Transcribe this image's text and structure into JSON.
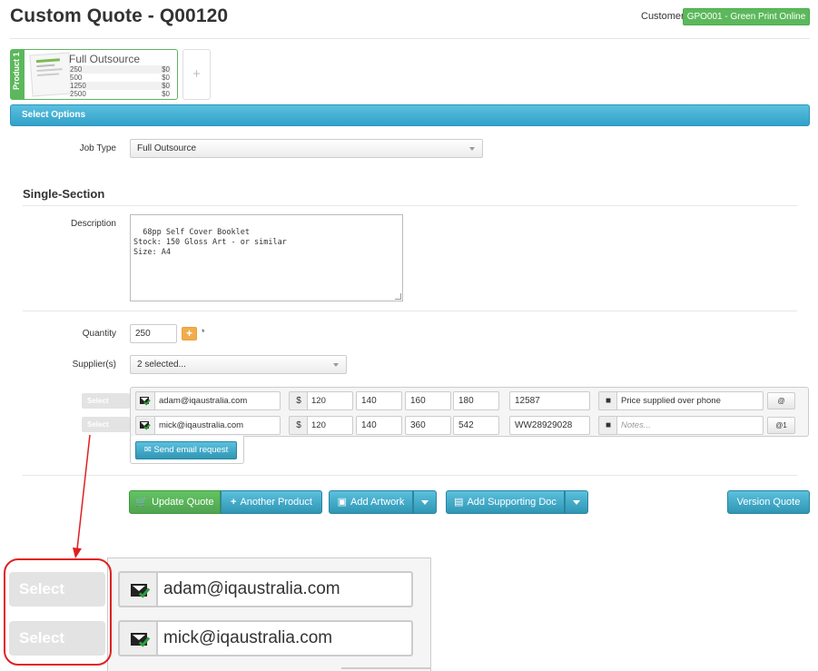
{
  "header": {
    "title": "Custom Quote - Q00120",
    "customer_label": "Customer",
    "customer_value": "GPO001 - Green Print Online"
  },
  "product": {
    "tab_label": "Product 1",
    "name": "Full Outsource",
    "prices": [
      {
        "qty": "250",
        "price": "$0"
      },
      {
        "qty": "500",
        "price": "$0"
      },
      {
        "qty": "1250",
        "price": "$0"
      },
      {
        "qty": "2500",
        "price": "$0"
      }
    ],
    "add_label": "+"
  },
  "options": {
    "bar_title": "Select Options",
    "job_type_label": "Job Type",
    "job_type_value": "Full Outsource"
  },
  "section": {
    "title": "Single-Section",
    "description_label": "Description",
    "description_value": "68pp Self Cover Booklet\nStock: 150 Gloss Art - or similar\nSize: A4",
    "quantity_label": "Quantity",
    "quantity_value": "250",
    "quantity_plus": "+",
    "required_mark": "*",
    "suppliers_label": "Supplier(s)",
    "suppliers_value": "2 selected..."
  },
  "suppliers": {
    "select_label": "Select",
    "currency": "$",
    "rows": [
      {
        "email": "adam@iqaustralia.com",
        "p1": "120",
        "p2": "140",
        "p3": "160",
        "p4": "180",
        "ref": "12587",
        "note": "Price supplied over phone",
        "note_placeholder": "",
        "at_label": "@"
      },
      {
        "email": "mick@iqaustralia.com",
        "p1": "120",
        "p2": "140",
        "p3": "360",
        "p4": "542",
        "ref": "WW28929028",
        "note": "",
        "note_placeholder": "Notes...",
        "at_label": "@1"
      }
    ],
    "send_label": "Send email request"
  },
  "actions": {
    "update_quote": "Update Quote",
    "another_product": "Another Product",
    "add_artwork": "Add Artwork",
    "add_supporting_doc": "Add Supporting Doc",
    "version_quote": "Version Quote"
  },
  "zoom": {
    "select_label": "Select",
    "emails": [
      "adam@iqaustralia.com",
      "mick@iqaustralia.com"
    ]
  },
  "colors": {
    "green": "#5cb85c",
    "blue": "#31a1c9",
    "orange": "#f0ad4e",
    "red_annotation": "#e02020"
  },
  "icons": [
    "mail-check-icon",
    "comment-icon",
    "cart-icon",
    "plus-icon",
    "image-icon",
    "document-icon",
    "caret-down-icon"
  ]
}
